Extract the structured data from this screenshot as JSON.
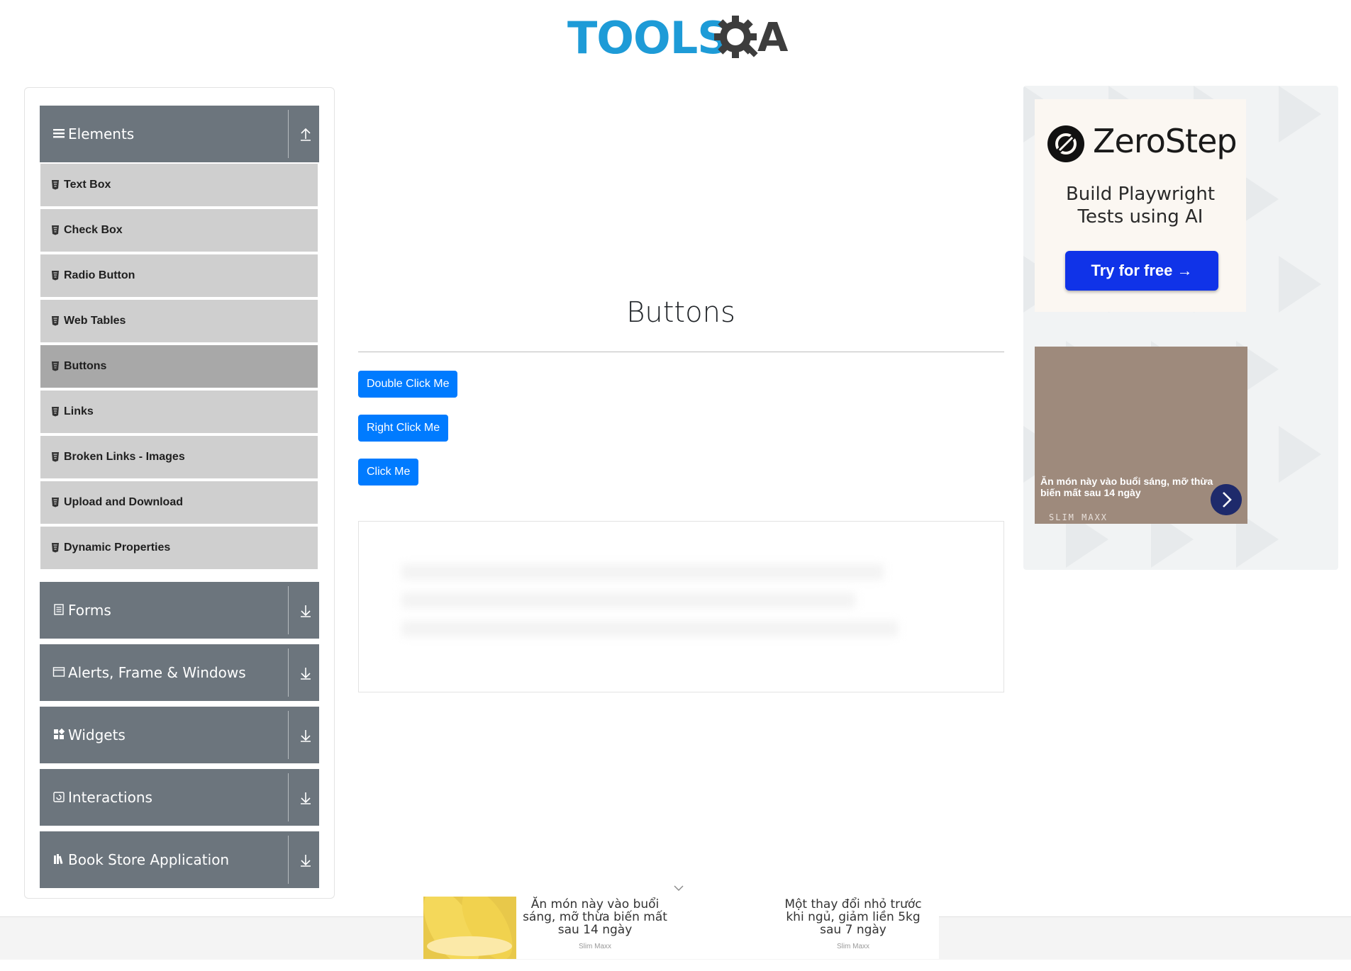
{
  "header": {
    "logo_text_left": "TOOLS",
    "logo_text_right": "QA"
  },
  "sidebar": {
    "groups": [
      {
        "label": "Elements",
        "icon": "hamburger-icon",
        "expanded": true
      },
      {
        "label": "Forms",
        "icon": "form-icon",
        "expanded": false
      },
      {
        "label": "Alerts, Frame & Windows",
        "icon": "window-icon",
        "expanded": false
      },
      {
        "label": "Widgets",
        "icon": "widgets-icon",
        "expanded": false
      },
      {
        "label": "Interactions",
        "icon": "interactions-icon",
        "expanded": false
      },
      {
        "label": "Book Store Application",
        "icon": "books-icon",
        "expanded": false
      }
    ],
    "items": [
      {
        "label": "Text Box"
      },
      {
        "label": "Check Box"
      },
      {
        "label": "Radio Button"
      },
      {
        "label": "Web Tables"
      },
      {
        "label": "Buttons",
        "active": true
      },
      {
        "label": "Links"
      },
      {
        "label": "Broken Links - Images"
      },
      {
        "label": "Upload and Download"
      },
      {
        "label": "Dynamic Properties"
      }
    ]
  },
  "main": {
    "title": "Buttons",
    "buttons": {
      "double_click": "Double Click Me",
      "right_click": "Right Click Me",
      "click": "Click Me"
    }
  },
  "ad_right": {
    "brand": "ZeroStep",
    "tagline_line1": "Build Playwright",
    "tagline_line2": "Tests using AI",
    "cta": "Try for free →",
    "promo_text": "Ăn món này vào buổi sáng, mỡ thừa biến mất sau 14 ngày",
    "promo_brand": "SLIM MAXX"
  },
  "bottom_ad": {
    "stories": [
      {
        "title": "Ăn món này vào buổi sáng, mỡ thừa biến mất sau 14 ngày",
        "source": "Slim Maxx"
      },
      {
        "title": "Một thay đổi nhỏ trước khi ngủ, giảm liền 5kg sau 7 ngày",
        "source": "Slim Maxx"
      }
    ]
  },
  "colors": {
    "logo_blue": "#1e9bd7",
    "logo_dark": "#3d3d3d",
    "group_header": "#6c757d",
    "menu_item": "#cfcfcf",
    "menu_item_active": "#a8a8a8",
    "primary_button": "#007bff",
    "zerostep_cta": "#1033e8"
  }
}
